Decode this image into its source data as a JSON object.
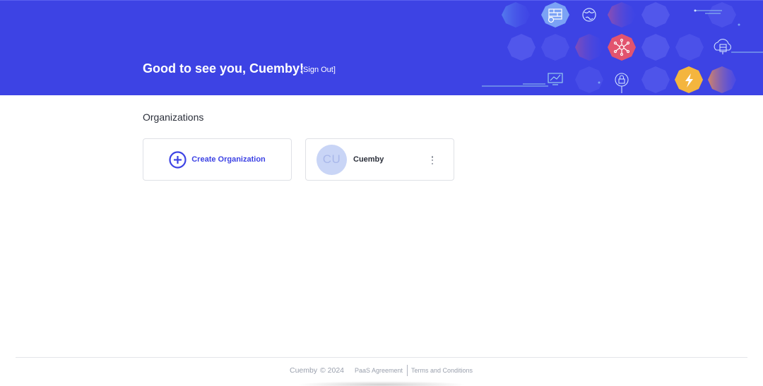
{
  "header": {
    "greeting": "Good to see you, Cuemby!",
    "sign_out": "[Sign Out]",
    "accent_color": "#3d43e4"
  },
  "organizations": {
    "title": "Organizations",
    "create_label": "Create Organization",
    "items": [
      {
        "initials": "CU",
        "name": "Cuemby"
      }
    ]
  },
  "footer": {
    "brand": "Cuemby",
    "year": "© 2024",
    "links": [
      "PaaS Agreement",
      "Terms and Conditions"
    ]
  },
  "icons": {
    "create": "plus-circle-icon",
    "menu": "kebab-menu-icon",
    "header_decor": [
      "firewall-icon",
      "globe-icon",
      "network-hub-icon",
      "cloud-server-icon",
      "monitor-chart-icon",
      "lock-icon",
      "lightning-icon"
    ]
  }
}
